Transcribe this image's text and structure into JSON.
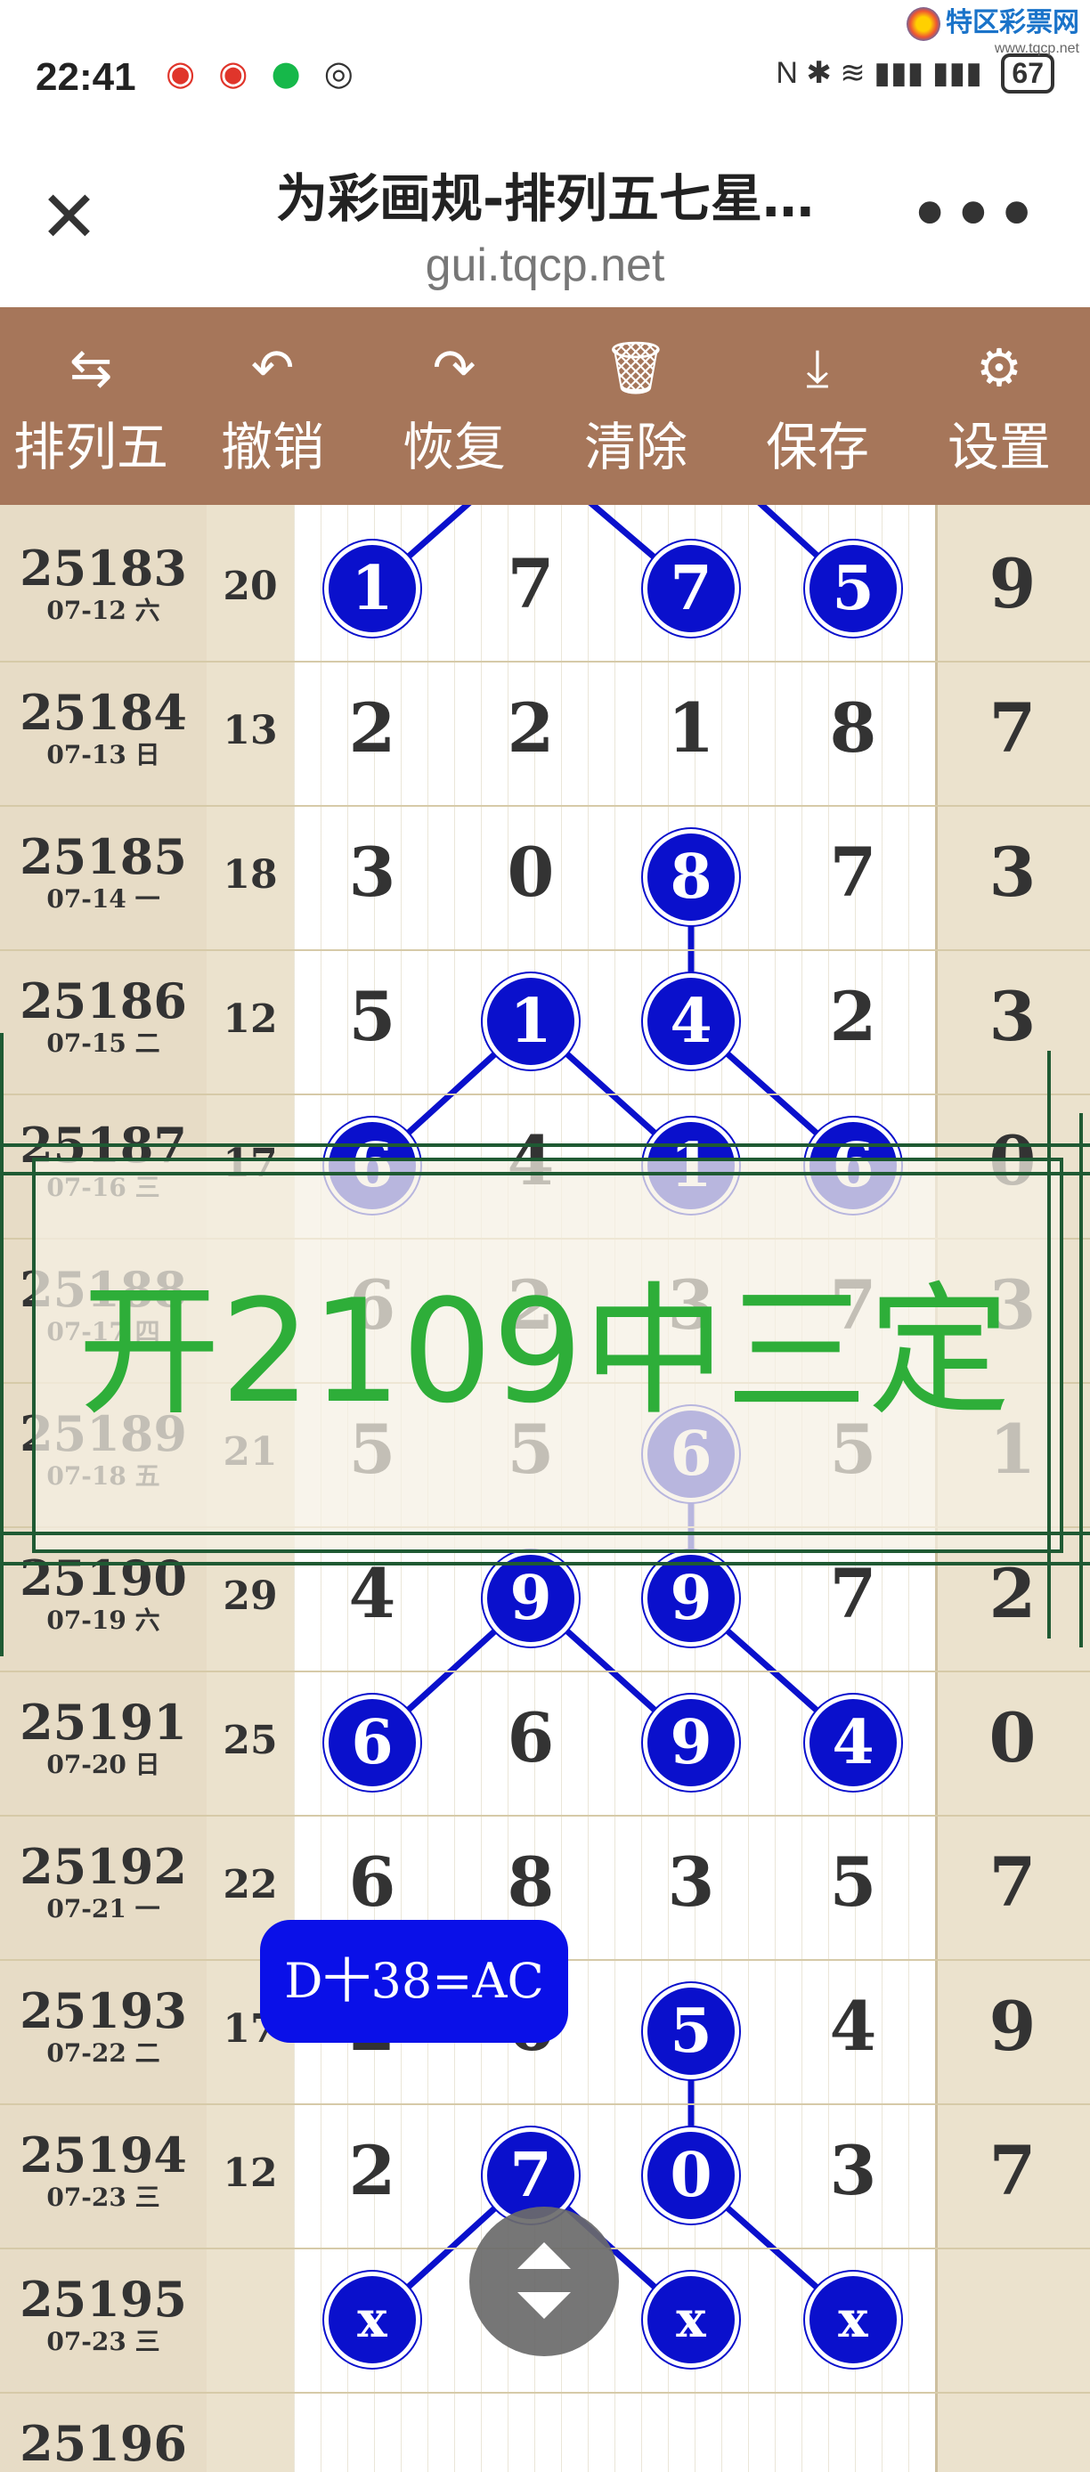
{
  "status": {
    "time": "22:41",
    "icons": [
      "weibo-icon",
      "weibo-icon",
      "wechat-icon",
      "eye-icon"
    ],
    "right_icons": "N ✱ ≋ ▮▮▮ ▮▮▮",
    "battery": "67"
  },
  "watermark": {
    "name": "特区彩票网",
    "url": "www.tqcp.net"
  },
  "header": {
    "title": "为彩画规-排列五七星…",
    "url": "gui.tqcp.net",
    "close": "✕",
    "more": "•••"
  },
  "toolbar": {
    "items": [
      {
        "label": "排列五",
        "icon": "⇆"
      },
      {
        "label": "撤销",
        "icon": "↶"
      },
      {
        "label": "恢复",
        "icon": "↷"
      },
      {
        "label": "清除",
        "icon": "🗑"
      },
      {
        "label": "保存",
        "icon": "⤓"
      },
      {
        "label": "设置",
        "icon": "⚙"
      }
    ]
  },
  "rows": [
    {
      "issue": "25183",
      "date": "07-12 六",
      "sum": "20",
      "digits": [
        "1",
        "7",
        "7",
        "5"
      ],
      "extra": "9"
    },
    {
      "issue": "25184",
      "date": "07-13 日",
      "sum": "13",
      "digits": [
        "2",
        "2",
        "1",
        "8"
      ],
      "extra": "7"
    },
    {
      "issue": "25185",
      "date": "07-14 一",
      "sum": "18",
      "digits": [
        "3",
        "0",
        "8",
        "7"
      ],
      "extra": "3"
    },
    {
      "issue": "25186",
      "date": "07-15 二",
      "sum": "12",
      "digits": [
        "5",
        "1",
        "4",
        "2"
      ],
      "extra": "3"
    },
    {
      "issue": "25187",
      "date": "07-16 三",
      "sum": "17",
      "digits": [
        "6",
        "4",
        "1",
        "6"
      ],
      "extra": "0"
    },
    {
      "issue": "25188",
      "date": "07-17 四",
      "sum": "",
      "digits": [
        "6",
        "2",
        "3",
        "7"
      ],
      "extra": "3"
    },
    {
      "issue": "25189",
      "date": "07-18 五",
      "sum": "21",
      "digits": [
        "5",
        "5",
        "6",
        "5"
      ],
      "extra": "1"
    },
    {
      "issue": "25190",
      "date": "07-19 六",
      "sum": "29",
      "digits": [
        "4",
        "9",
        "9",
        "7"
      ],
      "extra": "2"
    },
    {
      "issue": "25191",
      "date": "07-20 日",
      "sum": "25",
      "digits": [
        "6",
        "6",
        "9",
        "4"
      ],
      "extra": "0"
    },
    {
      "issue": "25192",
      "date": "07-21 一",
      "sum": "22",
      "digits": [
        "6",
        "8",
        "3",
        "5"
      ],
      "extra": "7"
    },
    {
      "issue": "25193",
      "date": "07-22 二",
      "sum": "17",
      "digits": [
        "2",
        "6",
        "5",
        "4"
      ],
      "extra": "9"
    },
    {
      "issue": "25194",
      "date": "07-23 三",
      "sum": "12",
      "digits": [
        "2",
        "7",
        "0",
        "3"
      ],
      "extra": "7"
    },
    {
      "issue": "25195",
      "date": "07-23 三",
      "sum": "",
      "digits": [
        "X",
        "",
        "X",
        "X"
      ],
      "extra": ""
    },
    {
      "issue": "25196",
      "date": "",
      "sum": "",
      "digits": [
        "",
        "",
        "",
        ""
      ],
      "extra": ""
    }
  ],
  "balls": [
    [
      0,
      0
    ],
    [
      0,
      2
    ],
    [
      0,
      3
    ],
    [
      2,
      2
    ],
    [
      3,
      1
    ],
    [
      3,
      2
    ],
    [
      4,
      0
    ],
    [
      4,
      2
    ],
    [
      4,
      3
    ],
    [
      6,
      2
    ],
    [
      7,
      1
    ],
    [
      7,
      2
    ],
    [
      8,
      0
    ],
    [
      8,
      2
    ],
    [
      8,
      3
    ],
    [
      10,
      2
    ],
    [
      11,
      1
    ],
    [
      11,
      2
    ],
    [
      12,
      0
    ],
    [
      12,
      2
    ],
    [
      12,
      3
    ]
  ],
  "ball_color": "#0a10cc",
  "overlay": {
    "text": "开2109中三定",
    "color": "#2eae39"
  },
  "tooltip": {
    "text": "D十38=AC"
  }
}
